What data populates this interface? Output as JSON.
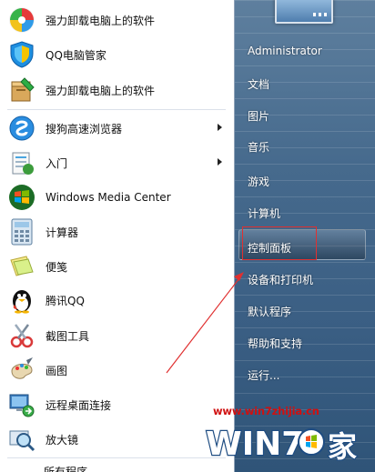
{
  "left_menu": {
    "items": [
      {
        "label": "强力卸载电脑上的软件",
        "icon": "uninstall-pinwheel-icon"
      },
      {
        "label": "QQ电脑管家",
        "icon": "qq-guard-shield-icon"
      },
      {
        "label": "强力卸载电脑上的软件",
        "icon": "uninstall-box-icon"
      },
      {
        "label": "搜狗高速浏览器",
        "icon": "sogou-browser-icon"
      },
      {
        "label": "入门",
        "icon": "getting-started-icon"
      },
      {
        "label": "Windows Media Center",
        "icon": "windows-logo-icon"
      },
      {
        "label": "计算器",
        "icon": "calculator-icon"
      },
      {
        "label": "便笺",
        "icon": "sticky-notes-icon"
      },
      {
        "label": "腾讯QQ",
        "icon": "qq-penguin-icon"
      },
      {
        "label": "截图工具",
        "icon": "snipping-tool-icon"
      },
      {
        "label": "画图",
        "icon": "paint-icon"
      },
      {
        "label": "远程桌面连接",
        "icon": "remote-desktop-icon"
      },
      {
        "label": "放大镜",
        "icon": "magnifier-icon"
      }
    ],
    "all_programs": "所有程序"
  },
  "right_menu": {
    "items": [
      {
        "label": "Administrator"
      },
      {
        "label": "文档"
      },
      {
        "label": "图片"
      },
      {
        "label": "音乐"
      },
      {
        "label": "游戏"
      },
      {
        "label": "计算机"
      },
      {
        "label": "控制面板"
      },
      {
        "label": "设备和打印机"
      },
      {
        "label": "默认程序"
      },
      {
        "label": "帮助和支持"
      },
      {
        "label": "运行..."
      }
    ]
  },
  "watermark": {
    "url": "www.win7zhijia.cn",
    "logo_text": "WIN7",
    "logo_suffix": "家"
  },
  "colors": {
    "annotation_red": "#e03030",
    "watermark_red": "#d01010"
  }
}
